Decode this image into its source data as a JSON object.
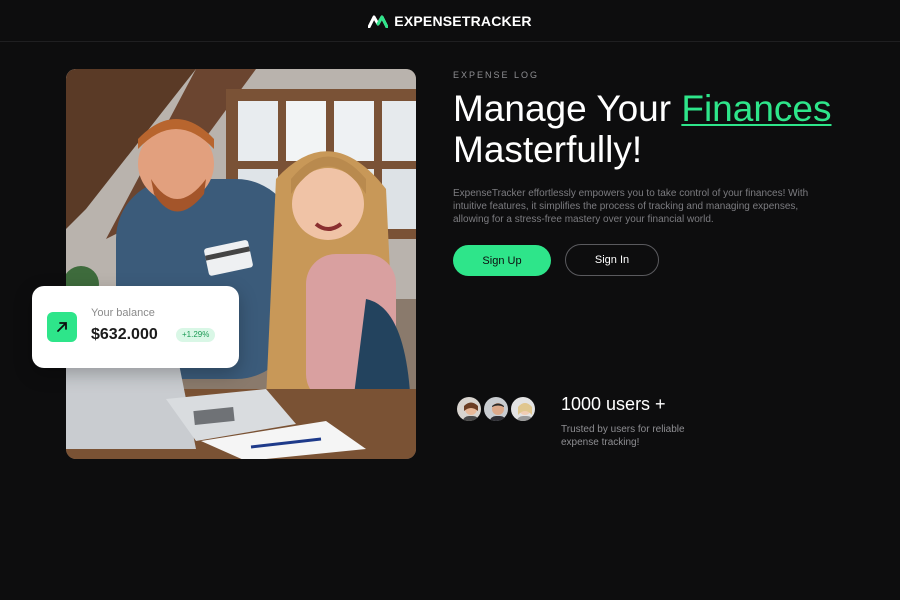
{
  "header": {
    "brand_name": "EXPENSETRACKER",
    "logo_icon": "brand-logo-icon",
    "accent_color": "#2ee58a"
  },
  "hero": {
    "image": "couple-with-laptop-and-credit-card-photo",
    "balance_card": {
      "label": "Your balance",
      "amount": "$632.000",
      "change": "+1.29%",
      "icon": "arrow-up-right-icon"
    }
  },
  "content": {
    "eyebrow": "EXPENSE LOG",
    "headline_part1": "Manage Your ",
    "headline_accent": "Finances",
    "headline_part2": "Masterfully!",
    "description": "ExpenseTracker effortlessly empowers you to take control of your finances! With intuitive features, it simplifies the process of tracking and managing expenses, allowing for a stress-free mastery over your financial world.",
    "signup_label": "Sign Up",
    "signin_label": "Sign In"
  },
  "social_proof": {
    "count_text": "1000 users +",
    "subtext": "Trusted by users for reliable expense tracking!"
  }
}
